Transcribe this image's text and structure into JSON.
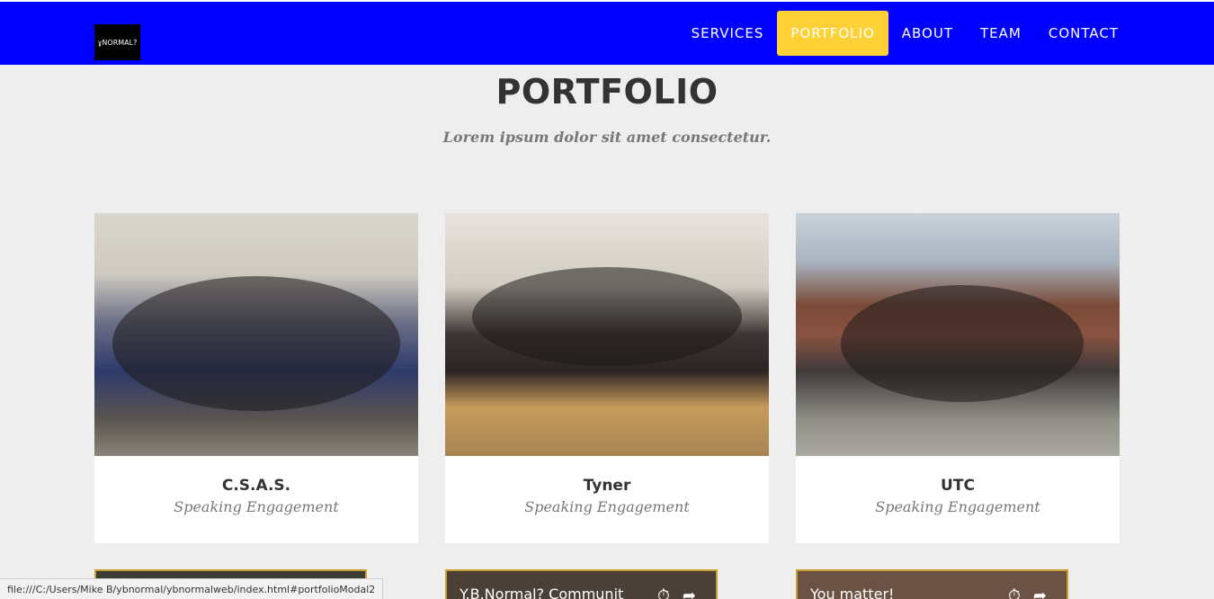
{
  "logo": {
    "text": "ɣNORMAL?"
  },
  "nav": {
    "items": [
      {
        "label": "SERVICES",
        "active": false
      },
      {
        "label": "PORTFOLIO",
        "active": true
      },
      {
        "label": "ABOUT",
        "active": false
      },
      {
        "label": "TEAM",
        "active": false
      },
      {
        "label": "CONTACT",
        "active": false
      }
    ]
  },
  "section": {
    "heading": "PORTFOLIO",
    "subheading": "Lorem ipsum dolor sit amet consectetur."
  },
  "portfolio": [
    {
      "title": "C.S.A.S.",
      "subtitle": "Speaking Engagement"
    },
    {
      "title": "Tyner",
      "subtitle": "Speaking Engagement"
    },
    {
      "title": "UTC",
      "subtitle": "Speaking Engagement"
    }
  ],
  "videos": [
    {
      "title": ""
    },
    {
      "title": "Y.B.Normal? Communit"
    },
    {
      "title": "You matter!"
    }
  ],
  "status_bar": {
    "url": "file:///C:/Users/Mike B/ybnormal/ybnormalweb/index.html#portfolioModal2"
  },
  "colors": {
    "navbar": "#0000ff",
    "accent": "#fed136",
    "background": "#eeeeee"
  }
}
